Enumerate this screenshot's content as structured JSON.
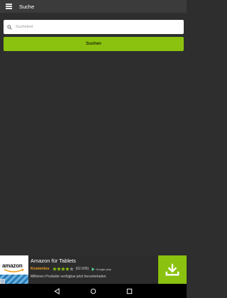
{
  "appbar": {
    "title": "Suche",
    "menu_icon": "hamburger-menu-icon"
  },
  "search": {
    "placeholder": "Suchetext",
    "value": "",
    "icon": "search-icon",
    "button_label": "Suchen"
  },
  "ad": {
    "logo_text": "amazon",
    "title": "Amazon für Tablets",
    "price": "Kostenlos",
    "stars": 4.5,
    "rating_count": "(62.605)",
    "store_label": "Google play",
    "description": "Millionen Produkte verfügbar jetzt herunterladen",
    "download_icon": "download-icon",
    "ad_choices_icon": "ad-choices-icon"
  },
  "navbar": {
    "back_icon": "back-icon",
    "home_icon": "home-icon",
    "recents_icon": "recents-icon"
  },
  "colors": {
    "background": "#2e2e2e",
    "appbar": "#3b3b3b",
    "accent": "#8bc20f",
    "price": "#f0a020"
  }
}
